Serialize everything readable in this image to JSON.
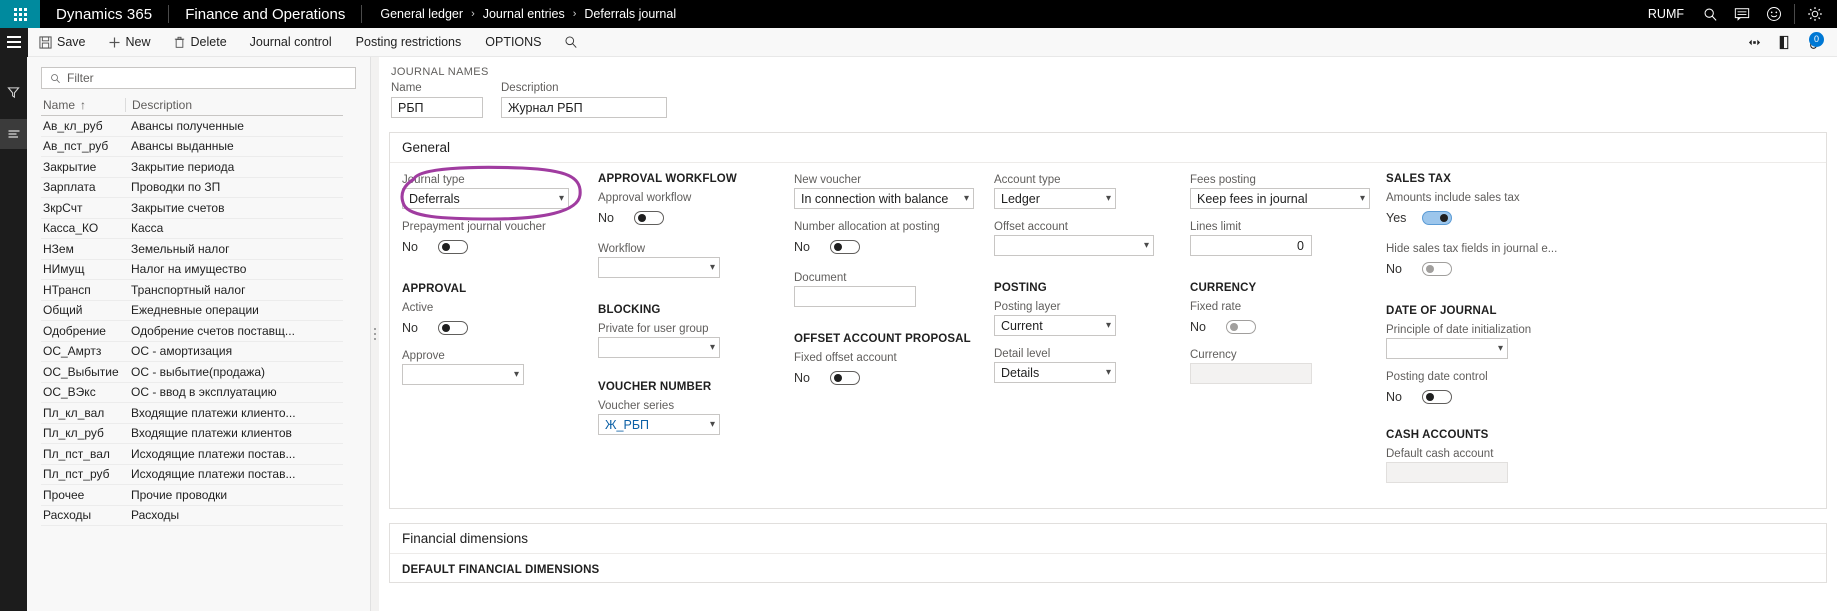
{
  "topbar": {
    "waffle_icon": "app-launcher-icon",
    "brand": "Dynamics 365",
    "module": "Finance and Operations",
    "breadcrumb": [
      "General ledger",
      "Journal entries",
      "Deferrals journal"
    ],
    "chevron": "›",
    "company": "RUMF",
    "icons": [
      "search-icon",
      "feedback-icon",
      "smiley-icon",
      "settings-gear-icon"
    ]
  },
  "actionpane": {
    "menu_icon": "hamburger-menu-icon",
    "save_label": "Save",
    "new_label": "New",
    "delete_label": "Delete",
    "tabs": [
      "Journal control",
      "Posting restrictions",
      "OPTIONS"
    ],
    "search_icon": "search-icon",
    "right_icons": [
      "share-icon",
      "open-in-new-window-icon",
      "attachments-icon"
    ],
    "attachment_count": "0"
  },
  "leftrail": {
    "filter_icon": "funnel-filter-icon",
    "list_icon": "list-view-icon"
  },
  "list": {
    "filter_placeholder": "Filter",
    "filter_icon": "search-icon",
    "columns": [
      "Name",
      "Description"
    ],
    "sort_indicator": "↑",
    "rows": [
      {
        "name": "Ав_кл_руб",
        "description": "Авансы полученные"
      },
      {
        "name": "Ав_пст_руб",
        "description": " Авансы выданные"
      },
      {
        "name": "Закрытие",
        "description": "Закрытие периода"
      },
      {
        "name": "Зарплата",
        "description": "Проводки по ЗП"
      },
      {
        "name": "ЗкрСчт",
        "description": "Закрытие счетов"
      },
      {
        "name": "Касса_КО",
        "description": "Касса"
      },
      {
        "name": "НЗем",
        "description": "Земельный налог"
      },
      {
        "name": "НИмущ",
        "description": "Налог на имущество"
      },
      {
        "name": "НТрансп",
        "description": "Транспортный налог"
      },
      {
        "name": "Общий",
        "description": "Ежедневные операции"
      },
      {
        "name": "Одобрение",
        "description": "Одобрение счетов поставщ..."
      },
      {
        "name": "ОС_Амртз",
        "description": "ОС - амортизация"
      },
      {
        "name": "ОС_Выбытие",
        "description": "ОС - выбытие(продажа)"
      },
      {
        "name": "ОС_ВЭкс",
        "description": "ОС - ввод в эксплуатацию"
      },
      {
        "name": "Пл_кл_вал",
        "description": "Входящие платежи клиенто..."
      },
      {
        "name": "Пл_кл_руб",
        "description": "Входящие платежи клиентов"
      },
      {
        "name": "Пл_пст_вал",
        "description": "Исходящие платежи постав..."
      },
      {
        "name": "Пл_пст_руб",
        "description": "Исходящие платежи постав..."
      },
      {
        "name": "Прочее",
        "description": "Прочие проводки"
      },
      {
        "name": "Расходы",
        "description": "Расходы"
      }
    ]
  },
  "detail": {
    "caption": "JOURNAL NAMES",
    "name_label": "Name",
    "name_value": "РБП",
    "description_label": "Description",
    "description_value": "Журнал РБП"
  },
  "general": {
    "title": "General",
    "highlight_color": "#a03ca0",
    "col1": {
      "journal_type_label": "Journal type",
      "journal_type_value": "Deferrals",
      "prepayment_label": "Prepayment journal voucher",
      "prepayment_value": "No",
      "approval_title": "APPROVAL",
      "active_label": "Active",
      "active_value": "No",
      "approve_label": "Approve",
      "approve_value": ""
    },
    "col2": {
      "approval_workflow_title": "APPROVAL WORKFLOW",
      "approval_workflow_label": "Approval workflow",
      "approval_workflow_value": "No",
      "workflow_label": "Workflow",
      "workflow_value": "",
      "blocking_title": "BLOCKING",
      "private_label": "Private for user group",
      "private_value": "",
      "voucher_number_title": "VOUCHER NUMBER",
      "voucher_series_label": "Voucher series",
      "voucher_series_value": "Ж_РБП"
    },
    "col3": {
      "new_voucher_label": "New voucher",
      "new_voucher_value": "In connection with balance",
      "number_allocation_label": "Number allocation at posting",
      "number_allocation_value": "No",
      "document_label": "Document",
      "document_value": "",
      "offset_proposal_title": "OFFSET ACCOUNT PROPOSAL",
      "fixed_offset_label": "Fixed offset account",
      "fixed_offset_value": "No"
    },
    "col4": {
      "account_type_label": "Account type",
      "account_type_value": "Ledger",
      "offset_account_label": "Offset account",
      "offset_account_value": "",
      "posting_title": "POSTING",
      "posting_layer_label": "Posting layer",
      "posting_layer_value": "Current",
      "detail_level_label": "Detail level",
      "detail_level_value": "Details"
    },
    "col5": {
      "fees_posting_label": "Fees posting",
      "fees_posting_value": "Keep fees in journal",
      "lines_limit_label": "Lines limit",
      "lines_limit_value": "0",
      "currency_title": "CURRENCY",
      "fixed_rate_label": "Fixed rate",
      "fixed_rate_value": "No",
      "currency_label": "Currency",
      "currency_value": ""
    },
    "col6": {
      "sales_tax_title": "SALES TAX",
      "amounts_include_label": "Amounts include sales tax",
      "amounts_include_value": "Yes",
      "hide_tax_label": "Hide sales tax fields in journal e...",
      "hide_tax_value": "No",
      "date_title": "DATE OF JOURNAL",
      "principle_label": "Principle of date initialization",
      "principle_value": "",
      "posting_date_control_label": "Posting date control",
      "posting_date_control_value": "No",
      "cash_accounts_title": "CASH ACCOUNTS",
      "default_cash_label": "Default cash account",
      "default_cash_value": ""
    }
  },
  "financial_dimensions": {
    "title": "Financial dimensions",
    "default_title": "DEFAULT FINANCIAL DIMENSIONS"
  }
}
